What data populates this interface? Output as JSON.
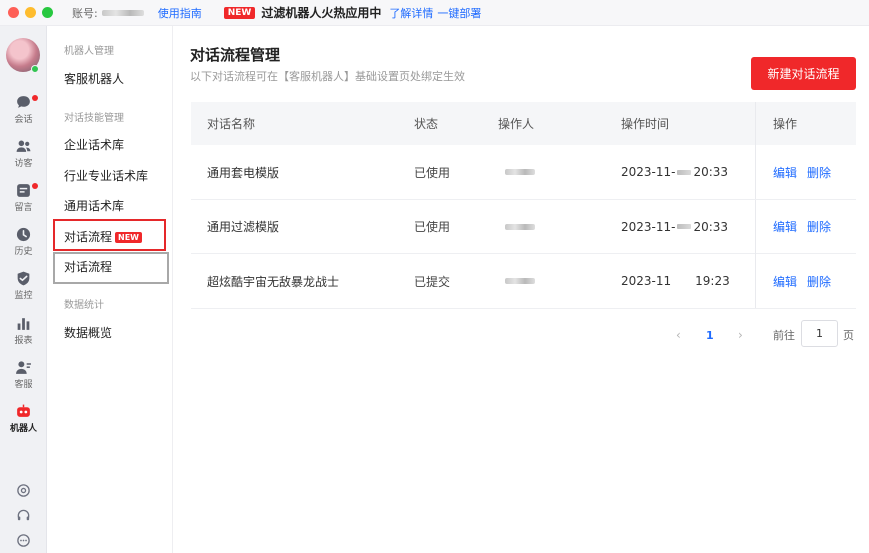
{
  "window": {
    "controls": [
      {
        "name": "close",
        "color": "#fe5f57"
      },
      {
        "name": "minimize",
        "color": "#febc2e"
      },
      {
        "name": "zoom",
        "color": "#28c840"
      }
    ]
  },
  "topbar": {
    "account_label": "账号:",
    "guide_link": "使用指南",
    "banner_badge": "NEW",
    "banner_text": "过滤机器人火热应用中",
    "learn_more": "了解详情",
    "one_click_deploy": "一键部署"
  },
  "rail": {
    "items": [
      {
        "label": "会话",
        "icon": "chat-bubble-icon",
        "has_dot": true
      },
      {
        "label": "访客",
        "icon": "visitors-icon",
        "has_dot": false
      },
      {
        "label": "留言",
        "icon": "message-icon",
        "has_dot": true
      },
      {
        "label": "历史",
        "icon": "clock-icon",
        "has_dot": false
      },
      {
        "label": "监控",
        "icon": "monitor-shield-icon",
        "has_dot": false
      },
      {
        "label": "报表",
        "icon": "bar-chart-icon",
        "has_dot": false
      },
      {
        "label": "客服",
        "icon": "agent-icon",
        "has_dot": false
      },
      {
        "label": "机器人",
        "icon": "robot-icon",
        "has_dot": false,
        "active": true
      }
    ],
    "bottom_icons": [
      "target-icon",
      "headset-icon",
      "more-icon"
    ]
  },
  "subnav": {
    "group_robot_mgmt": "机器人管理",
    "item_service_robot": "客服机器人",
    "group_skill_mgmt": "对话技能管理",
    "item_enterprise_lib": "企业话术库",
    "item_industry_lib": "行业专业话术库",
    "item_general_lib": "通用话术库",
    "item_flow_new": "对话流程",
    "item_flow_new_badge": "NEW",
    "item_flow": "对话流程",
    "group_stats": "数据统计",
    "item_data_overview": "数据概览"
  },
  "main": {
    "title": "对话流程管理",
    "subtitle": "以下对话流程可在【客服机器人】基础设置页处绑定生效",
    "new_button": "新建对话流程"
  },
  "table": {
    "columns": [
      "对话名称",
      "状态",
      "操作人",
      "操作时间",
      "操作"
    ],
    "rows": [
      {
        "name": "通用套电模版",
        "status": "已使用",
        "time_prefix": "2023-11-",
        "time_suffix": "20:33"
      },
      {
        "name": "通用过滤模版",
        "status": "已使用",
        "time_prefix": "2023-11-",
        "time_suffix": "20:33"
      },
      {
        "name": "超炫酷宇宙无敌暴龙战士",
        "status": "已提交",
        "time_prefix": "2023-11",
        "time_suffix": "19:23"
      }
    ],
    "actions": {
      "edit": "编辑",
      "delete": "删除"
    }
  },
  "pagination": {
    "prev": "‹",
    "current_page": "1",
    "next": "›",
    "goto_label": "前往",
    "goto_value": "1",
    "page_unit": "页"
  },
  "colors": {
    "accent_red": "#f0282a",
    "link_blue": "#1f6bff"
  }
}
